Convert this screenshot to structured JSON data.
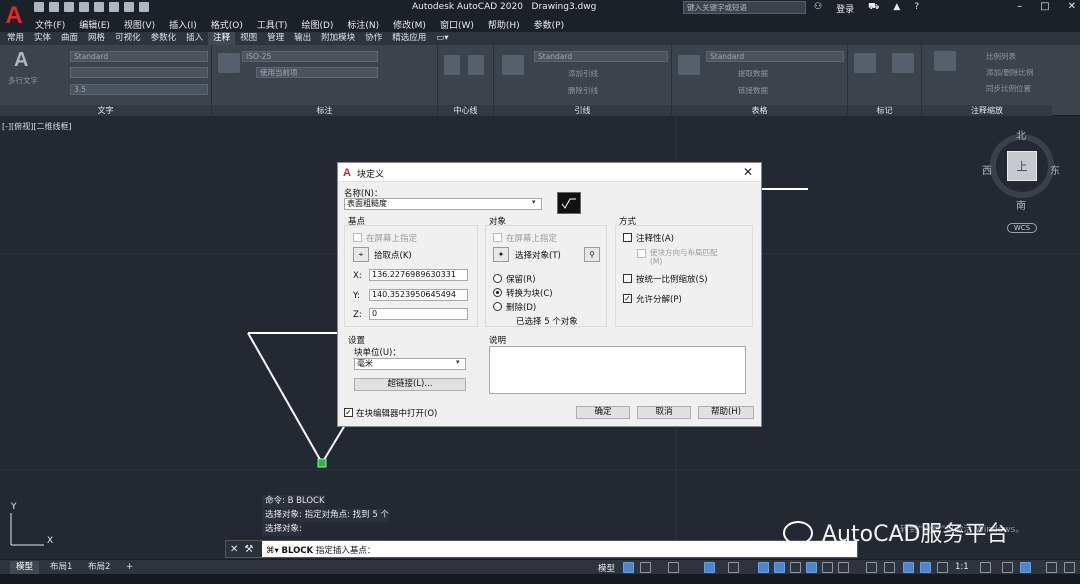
{
  "app": {
    "logo": "A",
    "title": "Autodesk AutoCAD 2020",
    "filename": "Drawing3.dwg",
    "search_placeholder": "键入关键字或短语",
    "login": "登录"
  },
  "menu": [
    "文件(F)",
    "编辑(E)",
    "视图(V)",
    "插入(I)",
    "格式(O)",
    "工具(T)",
    "绘图(D)",
    "标注(N)",
    "修改(M)",
    "窗口(W)",
    "帮助(H)",
    "参数(P)"
  ],
  "ribbon_tabs": [
    "常用",
    "实体",
    "曲面",
    "网格",
    "可视化",
    "参数化",
    "插入",
    "注释",
    "视图",
    "管理",
    "输出",
    "附加模块",
    "协作",
    "精选应用"
  ],
  "ribbon_active_tab": "注释",
  "ribbon": {
    "text": {
      "title": "文字",
      "big": "多行文字",
      "style": "Standard",
      "height": "3.5"
    },
    "dim": {
      "title": "标注",
      "style": "ISO-25",
      "layer": "使用当前项"
    },
    "centerline": {
      "title": "中心线"
    },
    "leader": {
      "title": "引线",
      "style": "Standard",
      "add": "添加引线",
      "remove": "删除引线"
    },
    "table": {
      "title": "表格",
      "style": "Standard",
      "extract": "提取数据",
      "link": "链接数据"
    },
    "mark": {
      "title": "标记"
    },
    "scale": {
      "title": "注释缩放",
      "s1": "比例列表",
      "s2": "添加/删除比例",
      "s3": "同步比例位置"
    }
  },
  "viewport_label": "[-][俯视][二维线框]",
  "viewcube": {
    "n": "北",
    "s": "南",
    "w": "西",
    "e": "东",
    "top": "上",
    "wcs": "WCS"
  },
  "dialog": {
    "title": "块定义",
    "name_label": "名称(N)：",
    "name_value": "表面粗糙度",
    "base": {
      "title": "基点",
      "onscreen": "在屏幕上指定",
      "pick": "拾取点(K)",
      "x_label": "X:",
      "x": "136.2276989630331",
      "y_label": "Y:",
      "y": "140.3523950645494",
      "z_label": "Z:",
      "z": "0"
    },
    "objects": {
      "title": "对象",
      "onscreen": "在屏幕上指定",
      "select": "选择对象(T)",
      "retain": "保留(R)",
      "convert": "转换为块(C)",
      "delete": "删除(D)",
      "count": "已选择 5 个对象"
    },
    "behavior": {
      "title": "方式",
      "annotative": "注释性(A)",
      "match": "使块方向与布局匹配(M)",
      "uniform": "按统一比例缩放(S)",
      "explode": "允许分解(P)"
    },
    "settings": {
      "title": "设置",
      "unit_label": "块单位(U)：",
      "unit": "毫米",
      "hyperlink": "超链接(L)..."
    },
    "description": {
      "title": "说明"
    },
    "open_editor": "在块编辑器中打开(O)",
    "ok": "确定",
    "cancel": "取消",
    "help": "帮助(H)"
  },
  "command_history": [
    "命令: B BLOCK",
    "选择对象: 指定对角点: 找到 5 个",
    "选择对象:"
  ],
  "command_prompt": {
    "cmd": "BLOCK",
    "text": "指定插入基点："
  },
  "layout_tabs": [
    "模型",
    "布局1",
    "布局2"
  ],
  "status": {
    "model": "模型",
    "scale": "1:1"
  },
  "ucs": {
    "x": "X",
    "y": "Y"
  },
  "watermark": "AutoCAD服务平台",
  "win_activation": "转到“设置”以激活 Windows。"
}
